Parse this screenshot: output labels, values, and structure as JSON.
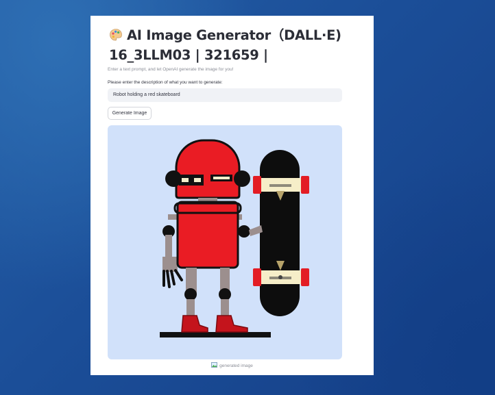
{
  "app": {
    "title_line1": "AI Image Generator（DALL·E)",
    "title_line2": "16_3LLM03 | 321659 |",
    "subtitle": "Enter a text prompt, and let OpenAI generate the image for you!",
    "prompt_label": "Please enter the description of what you want to generate:",
    "prompt_value": "Robot holding a red skateboard",
    "generate_label": "Generate Image",
    "image_caption": "generated image",
    "title_icon": "palette-icon",
    "caption_icon": "image-icon"
  },
  "colors": {
    "background": "#1b4e98",
    "card": "#ffffff",
    "image_bg": "#d1e1fa",
    "robot_red": "#ea1c24",
    "input_bg": "#f0f2f6"
  }
}
